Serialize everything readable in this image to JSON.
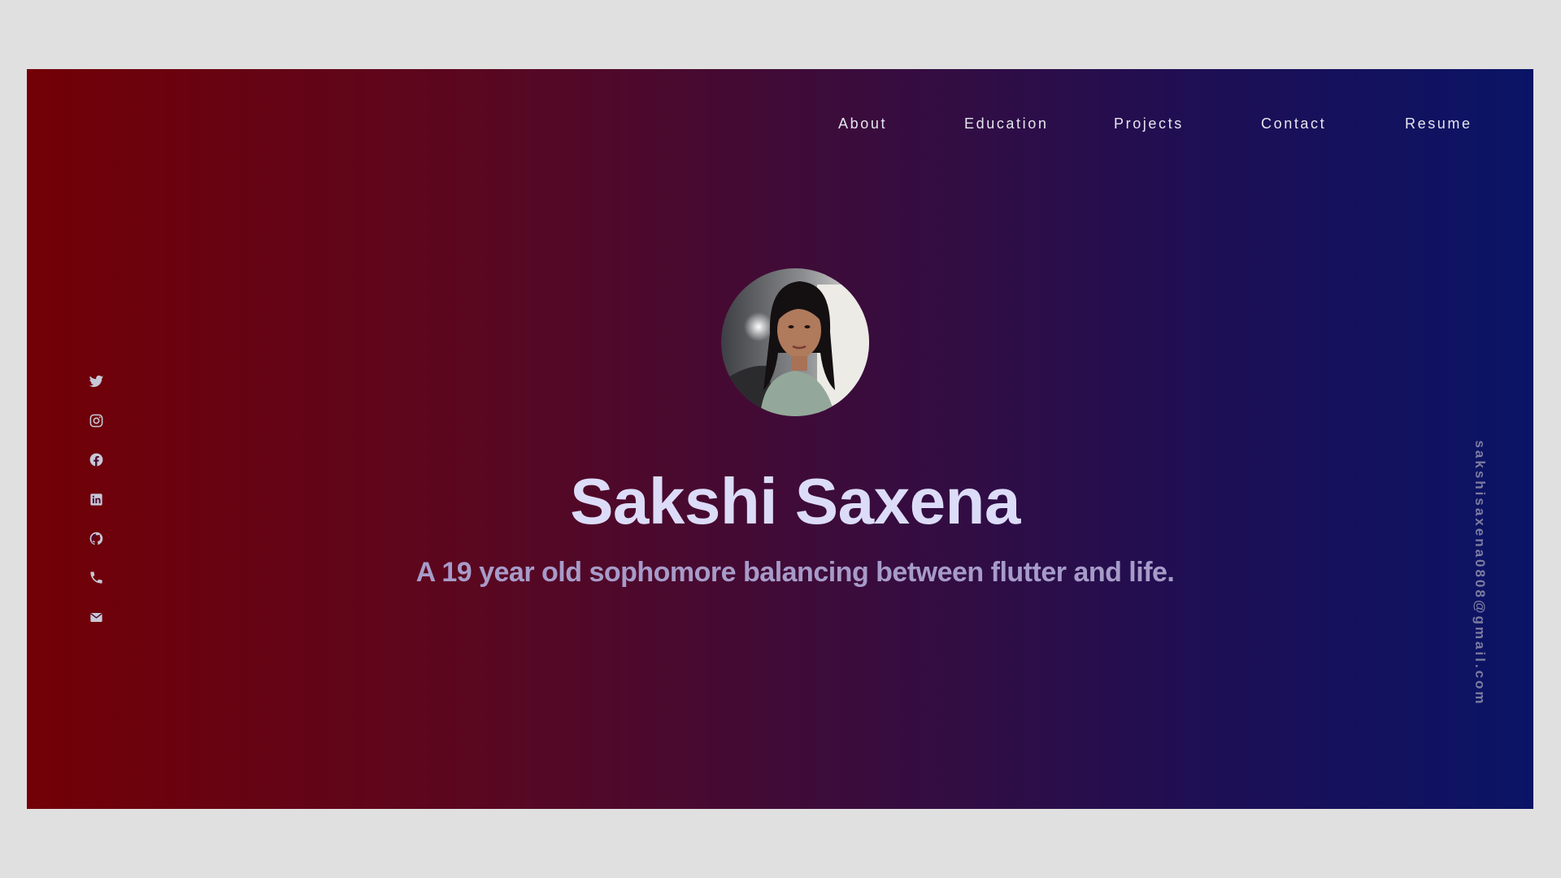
{
  "nav": {
    "about": "About",
    "education": "Education",
    "projects": "Projects",
    "contact": "Contact",
    "resume": "Resume"
  },
  "social": {
    "icons": [
      "twitter-icon",
      "instagram-icon",
      "facebook-icon",
      "linkedin-icon",
      "github-icon",
      "phone-icon",
      "mail-icon"
    ]
  },
  "hero": {
    "name": "Sakshi Saxena",
    "tagline": "A 19 year old sophomore balancing between flutter and life."
  },
  "sidebar": {
    "email": "sakshisaxena0808@gmail.com"
  },
  "colors": {
    "gradient_left": "#720006",
    "gradient_right": "#0a1466",
    "name_text": "#dcdcf8",
    "tagline_text": "#a79bc9",
    "email_text": "#7b7ca0",
    "icon_color": "#c8c8d8"
  }
}
